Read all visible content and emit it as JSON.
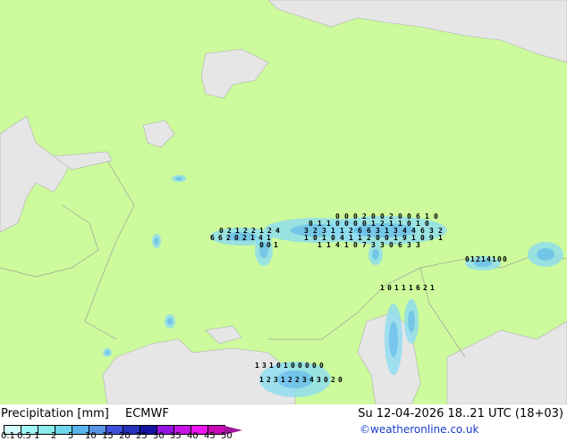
{
  "title": "Precipitation [mm]",
  "model": "ECMWF",
  "datetime": "Su 12-04-2026 18..21 UTC (18+03)",
  "credit": "©weatheronline.co.uk",
  "colors": {
    "land": "#ccfa9c",
    "sea": "#e6e6e6",
    "border": "#a0a0a0"
  },
  "scale": {
    "ticks": [
      "0.1",
      "0.5",
      "1",
      "2",
      "5",
      "10",
      "15",
      "20",
      "25",
      "30",
      "35",
      "40",
      "45",
      "50"
    ],
    "colors": [
      "#d2fafa",
      "#a0f5f5",
      "#8cebeb",
      "#6ed7eb",
      "#5ab4eb",
      "#5a96e6",
      "#3c50dc",
      "#2832be",
      "#1414a0",
      "#9614e6",
      "#c814e6",
      "#f014f0",
      "#c80ab4"
    ]
  },
  "map_labels": [
    "0",
    "0",
    "0",
    "2",
    "0",
    "0",
    "2",
    "0",
    "0",
    "6",
    "1",
    "0",
    "0",
    "1",
    "1",
    "0",
    "0",
    "0",
    "0",
    "1",
    "2",
    "1",
    "1",
    "0",
    "1",
    "0",
    "0",
    "2",
    "1",
    "2",
    "2",
    "1",
    "2",
    "4",
    "3",
    "2",
    "3",
    "1",
    "1",
    "2",
    "6",
    "6",
    "3",
    "1",
    "3",
    "4",
    "4",
    "6",
    "3",
    "2",
    "6",
    "6",
    "2",
    "0",
    "2",
    "1",
    "4",
    "1",
    "1",
    "0",
    "1",
    "0",
    "4",
    "1",
    "1",
    "2",
    "0",
    "0",
    "1",
    "9",
    "1",
    "0",
    "9",
    "1",
    "0",
    "0",
    "1",
    "1",
    "1",
    "4",
    "1",
    "0",
    "7",
    "3",
    "3",
    "0",
    "6",
    "3",
    "3",
    "0",
    "1",
    "2",
    "1",
    "4",
    "1",
    "0",
    "0",
    "1",
    "0",
    "1",
    "1",
    "1",
    "6",
    "2",
    "1",
    "1",
    "3",
    "1",
    "0",
    "1",
    "0",
    "0",
    "0",
    "0",
    "0",
    "1",
    "2",
    "3",
    "1",
    "2",
    "2",
    "3",
    "4",
    "3",
    "0",
    "2",
    "0",
    "0",
    "1"
  ]
}
